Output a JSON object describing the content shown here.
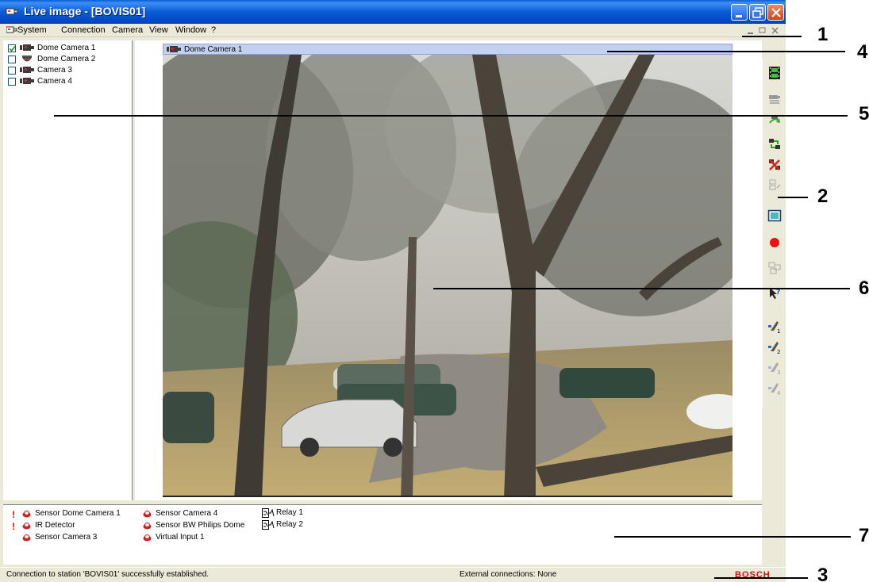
{
  "window": {
    "title": "Live image - [BOVIS01]",
    "title_bar_color": "#0a5cd6"
  },
  "menu": {
    "items": [
      "System",
      "Connection",
      "Camera",
      "View",
      "Window",
      "?"
    ]
  },
  "camera_tree": {
    "items": [
      {
        "label": "Dome Camera 1",
        "checked": true,
        "icon": "camera-icon"
      },
      {
        "label": "Dome Camera 2",
        "checked": false,
        "icon": "dome-camera-icon"
      },
      {
        "label": "Camera 3",
        "checked": false,
        "icon": "camera-icon"
      },
      {
        "label": "Camera 4",
        "checked": false,
        "icon": "camera-icon"
      }
    ]
  },
  "video": {
    "title": "Dome Camera 1"
  },
  "toolbar": {
    "icons": [
      "film-icon",
      "camera-list-icon",
      "refresh-icon",
      "connect-icon",
      "disconnect-icon",
      "disabled-tool-icon",
      "fullscreen-icon",
      "record-icon",
      "layout-icon",
      "help-icon",
      "preset-1-icon",
      "preset-2-icon",
      "preset-3-icon",
      "preset-4-icon"
    ]
  },
  "sensors": {
    "inputs": [
      {
        "label": "Sensor Dome Camera 1",
        "alarm": true
      },
      {
        "label": "IR Detector",
        "alarm": true
      },
      {
        "label": "Sensor Camera 3",
        "alarm": false
      },
      {
        "label": "Sensor Camera 4",
        "alarm": false
      },
      {
        "label": "Sensor BW Philips Dome",
        "alarm": false
      },
      {
        "label": "Virtual Input 1",
        "alarm": false
      }
    ],
    "relays": [
      {
        "label": "Relay 1"
      },
      {
        "label": "Relay 2"
      }
    ],
    "alarm_mark": "!"
  },
  "status": {
    "message": "Connection to station 'BOVIS01' successfully established.",
    "external": "External connections:  None",
    "brand": "BOSCH",
    "brand_color": "#d01010"
  },
  "callouts": [
    "1",
    "2",
    "3",
    "4",
    "5",
    "6",
    "7"
  ]
}
